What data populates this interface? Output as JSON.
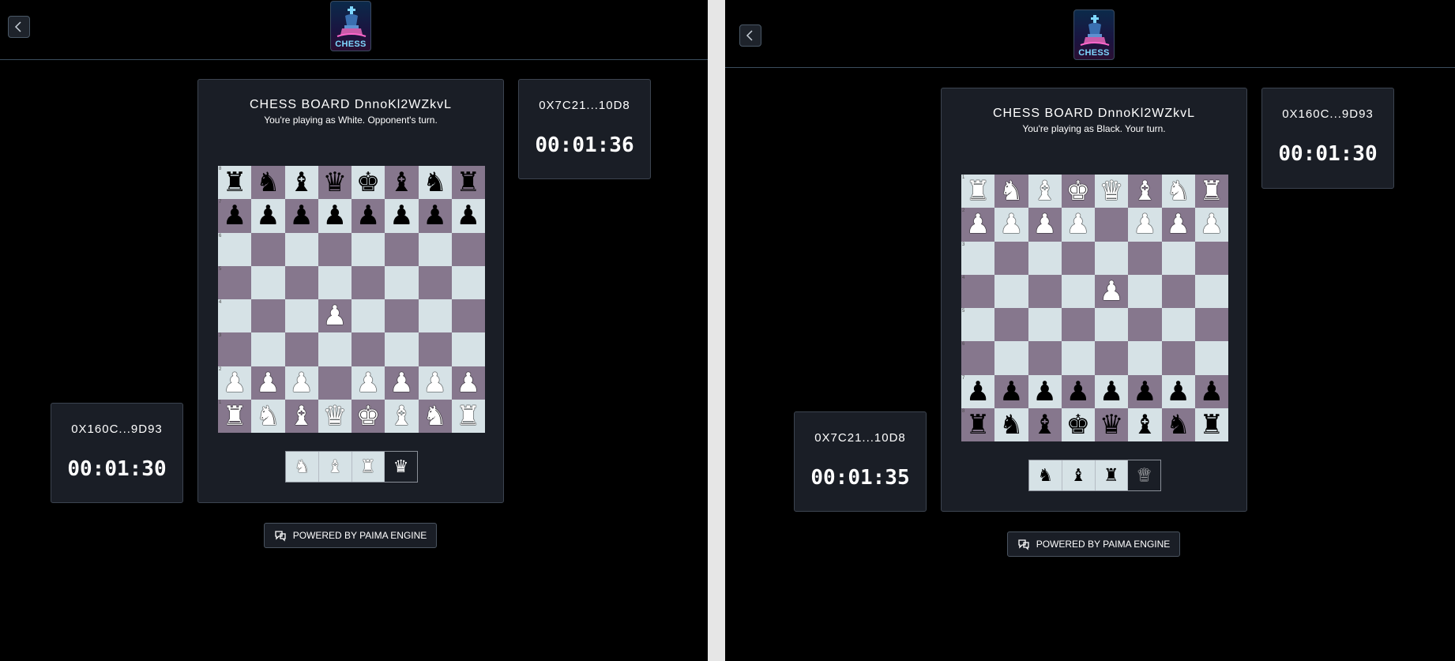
{
  "colors": {
    "light_square": "#d6e2e6",
    "dark_square": "#86778d",
    "panel": "#1a1e26",
    "accent_logo": "#7fd8ff"
  },
  "panes": [
    {
      "logo_text": "CHESS",
      "board_title": "CHESS BOARD DnnoKl2WZkvL",
      "status": "You're playing as White. Opponent's turn.",
      "orientation": "white",
      "rank_labels": [
        "8",
        "7",
        "6",
        "5",
        "4",
        "3",
        "2",
        "1"
      ],
      "board": [
        [
          "bR",
          "bN",
          "bB",
          "bQ",
          "bK",
          "bB",
          "bN",
          "bR"
        ],
        [
          "bP",
          "bP",
          "bP",
          "bP",
          "bP",
          "bP",
          "bP",
          "bP"
        ],
        [
          "",
          "",
          "",
          "",
          "",
          "",
          "",
          ""
        ],
        [
          "",
          "",
          "",
          "",
          "",
          "",
          "",
          ""
        ],
        [
          "",
          "",
          "",
          "wP",
          "",
          "",
          "",
          ""
        ],
        [
          "",
          "",
          "",
          "",
          "",
          "",
          "",
          ""
        ],
        [
          "wP",
          "wP",
          "wP",
          "",
          "wP",
          "wP",
          "wP",
          "wP"
        ],
        [
          "wR",
          "wN",
          "wB",
          "wQ",
          "wK",
          "wB",
          "wN",
          "wR"
        ]
      ],
      "promotion": {
        "color": "white",
        "pieces": [
          "knight",
          "bishop",
          "rook",
          "queen"
        ],
        "selected": "queen"
      },
      "opponent": {
        "address": "0X7C21...10D8",
        "time": "00:01:36"
      },
      "player": {
        "address": "0X160C...9D93",
        "time": "00:01:30"
      },
      "powered_label": "POWERED BY PAIMA ENGINE"
    },
    {
      "logo_text": "CHESS",
      "board_title": "CHESS BOARD DnnoKl2WZkvL",
      "status": "You're playing as Black. Your turn.",
      "orientation": "black",
      "rank_labels": [
        "1",
        "2",
        "3",
        "4",
        "5",
        "6",
        "7",
        "8"
      ],
      "board": [
        [
          "wR",
          "wN",
          "wB",
          "wK",
          "wQ",
          "wB",
          "wN",
          "wR"
        ],
        [
          "wP",
          "wP",
          "wP",
          "wP",
          "",
          "wP",
          "wP",
          "wP"
        ],
        [
          "",
          "",
          "",
          "",
          "",
          "",
          "",
          ""
        ],
        [
          "",
          "",
          "",
          "",
          "wP",
          "",
          "",
          ""
        ],
        [
          "",
          "",
          "",
          "",
          "",
          "",
          "",
          ""
        ],
        [
          "",
          "",
          "",
          "",
          "",
          "",
          "",
          ""
        ],
        [
          "bP",
          "bP",
          "bP",
          "bP",
          "bP",
          "bP",
          "bP",
          "bP"
        ],
        [
          "bR",
          "bN",
          "bB",
          "bK",
          "bQ",
          "bB",
          "bN",
          "bR"
        ]
      ],
      "promotion": {
        "color": "black",
        "pieces": [
          "knight",
          "bishop",
          "rook",
          "queen"
        ],
        "selected": "queen"
      },
      "opponent": {
        "address": "0X160C...9D93",
        "time": "00:01:30"
      },
      "player": {
        "address": "0X7C21...10D8",
        "time": "00:01:35"
      },
      "powered_label": "POWERED BY PAIMA ENGINE"
    }
  ]
}
